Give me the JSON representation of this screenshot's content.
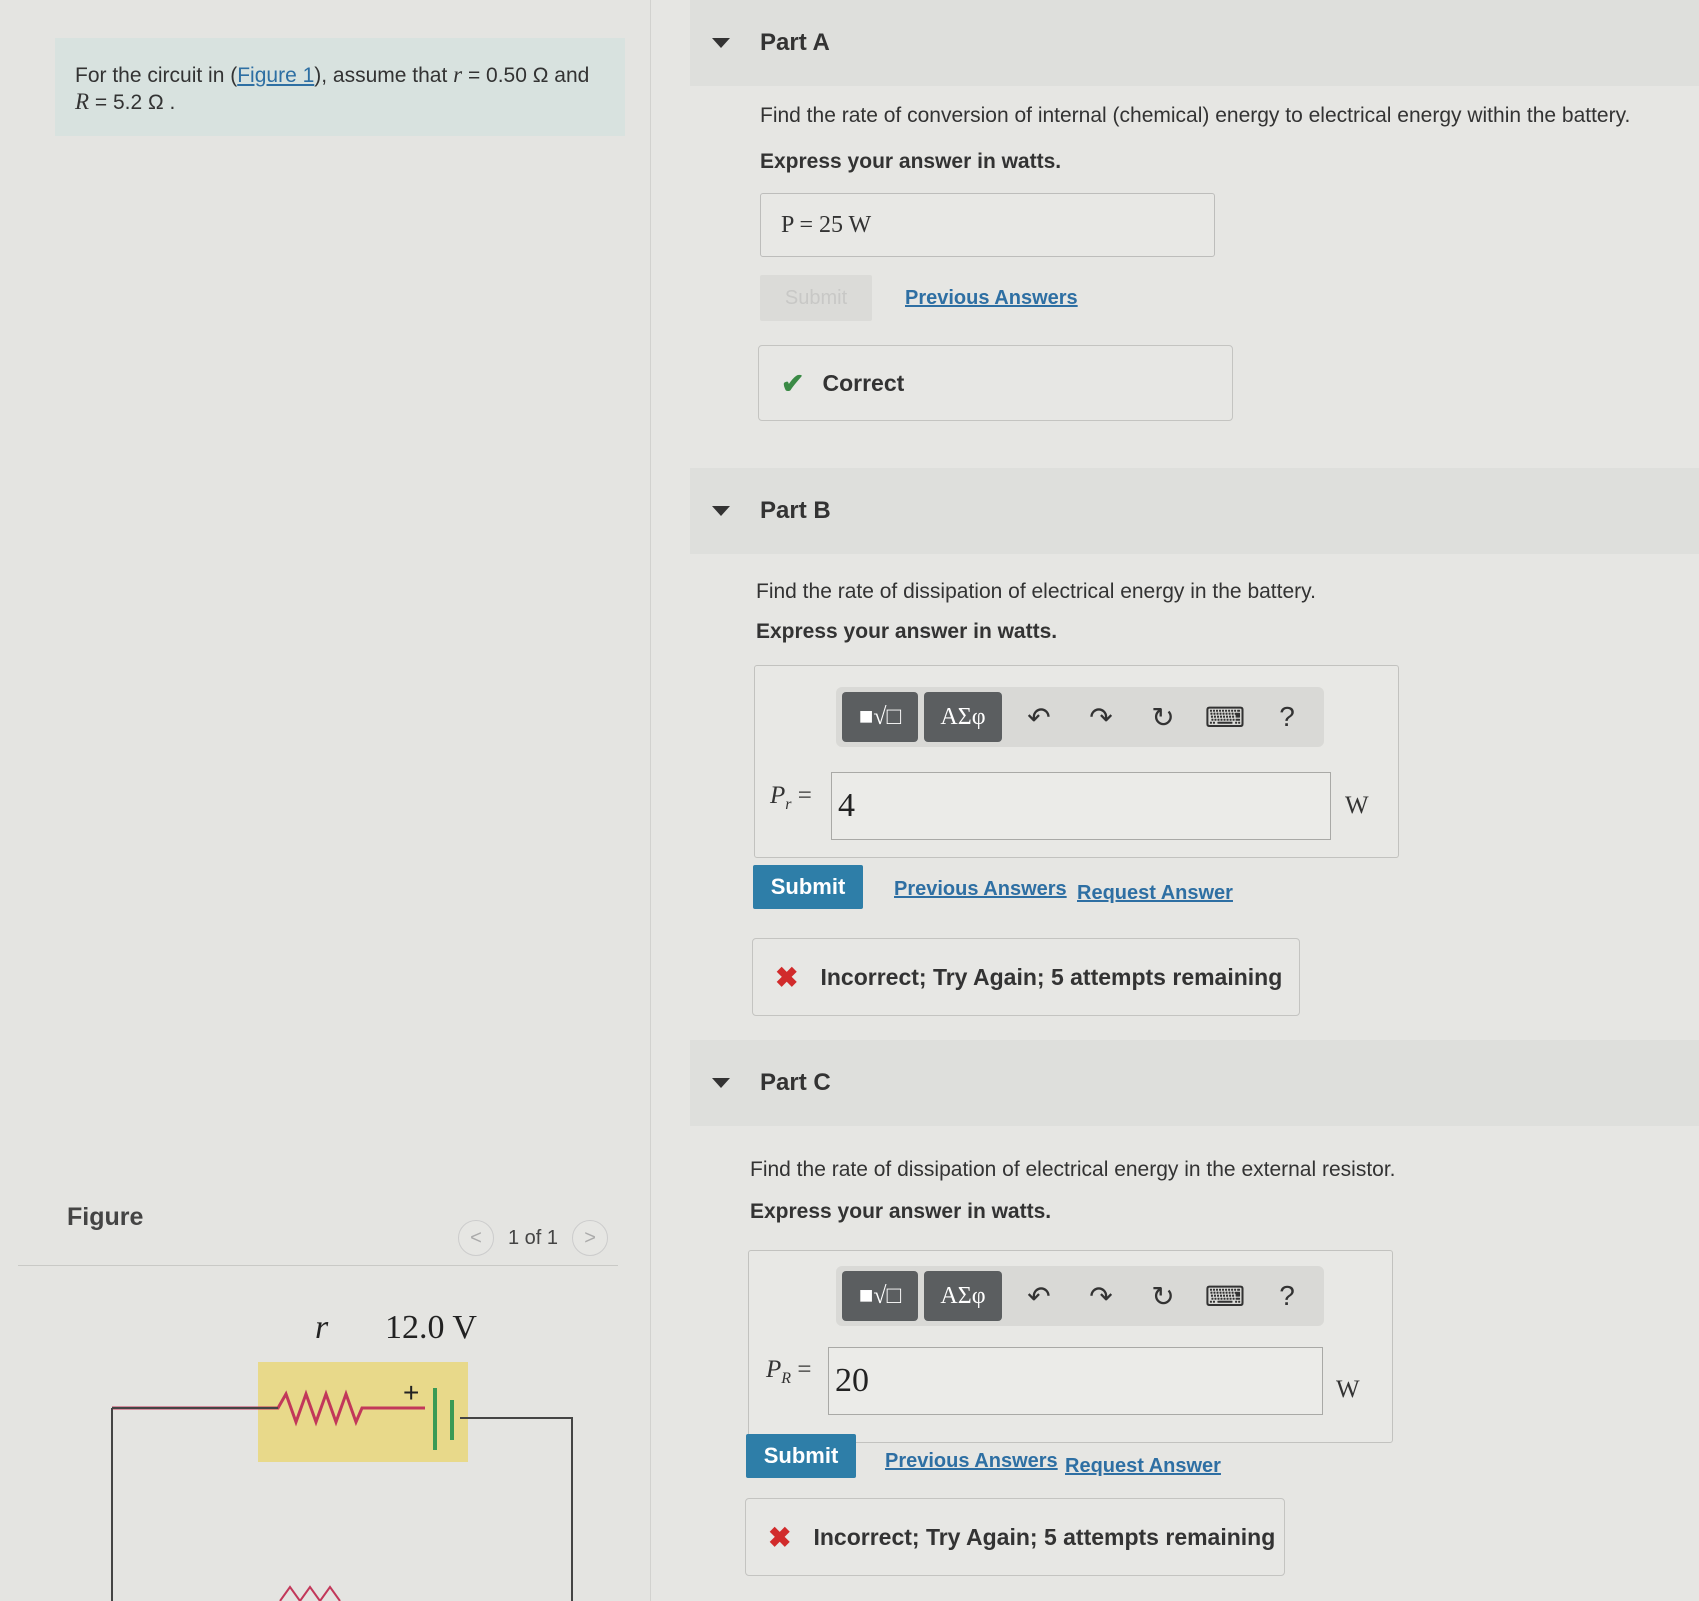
{
  "problem": {
    "text_before": "For the circuit in (",
    "figure_link": "Figure 1",
    "text_after": "), assume that ",
    "r_symbol": "r",
    "r_value": " = 0.50 Ω and",
    "R_symbol": "R",
    "R_value": " = 5.2 Ω ."
  },
  "figure": {
    "label": "Figure",
    "pager": "1 of 1",
    "prev": "<",
    "next": ">",
    "r_label": "r",
    "emf_label": "12.0 V",
    "plus": "+"
  },
  "partA": {
    "title": "Part A",
    "question": "Find the rate of conversion of internal (chemical) energy to electrical energy within the battery.",
    "instruction": "Express your answer in watts.",
    "answer": "P =  25  W",
    "submit": "Submit",
    "previous_answers": "Previous Answers",
    "feedback": "Correct"
  },
  "partB": {
    "title": "Part B",
    "question": "Find the rate of dissipation of electrical energy in the battery.",
    "instruction": "Express your answer in watts.",
    "tool_templates": "■√□",
    "tool_greek": "ΑΣφ",
    "help": "?",
    "var_main": "P",
    "var_sub": "r",
    "equals": " =",
    "value": "4",
    "unit": "W",
    "submit": "Submit",
    "previous_answers": "Previous Answers",
    "request_answer": "Request Answer",
    "feedback": "Incorrect; Try Again; 5 attempts remaining"
  },
  "partC": {
    "title": "Part C",
    "question": "Find the rate of dissipation of electrical energy in the external resistor.",
    "instruction": "Express your answer in watts.",
    "tool_templates": "■√□",
    "tool_greek": "ΑΣφ",
    "help": "?",
    "var_main": "P",
    "var_sub": "R",
    "equals": " =",
    "value": "20",
    "unit": "W",
    "submit": "Submit",
    "previous_answers": "Previous Answers",
    "request_answer": "Request Answer",
    "feedback": "Incorrect; Try Again; 5 attempts remaining"
  },
  "icons": [
    "caret-down-icon",
    "check-icon",
    "x-icon",
    "undo-icon",
    "redo-icon",
    "reset-icon",
    "keyboard-icon"
  ],
  "colors": {
    "submit": "#2e7ea8",
    "link": "#2e6fa3",
    "correct": "#3a8a45",
    "incorrect": "#d12b2b",
    "problem_bg": "#d8e2df",
    "battery_bg": "#e8d98a"
  }
}
